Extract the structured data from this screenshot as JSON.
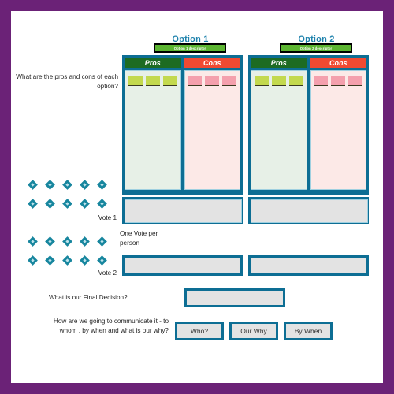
{
  "board": {
    "frame_color": "#6b2277",
    "canvas_color": "#ffffff",
    "accent_teal": "#0d6e94",
    "title_color": "#2083ad",
    "pros_color": "#1d6b22",
    "cons_color": "#f04a32",
    "sticky_green": "#c3d94e",
    "sticky_pink": "#f4a0ad",
    "box_fill": "#e3e3e3",
    "diamond_color": "#17869e"
  },
  "options": [
    {
      "title": "Option 1",
      "descriptor": "Option 1 descriptor",
      "pros_header": "Pros",
      "cons_header": "Cons",
      "pros_notes": 3,
      "cons_notes": 3
    },
    {
      "title": "Option 2",
      "descriptor": "Option 2 descriptor",
      "pros_header": "Pros",
      "cons_header": "Cons",
      "pros_notes": 3,
      "cons_notes": 3
    }
  ],
  "prompts": {
    "pros_cons_question": "What are the pros and cons of each option?",
    "one_vote_note": "One Vote per person",
    "final_decision_question": "What is our Final Decision?",
    "communicate_question": "How are we going to communicate it - to whom , by when and what is our why?"
  },
  "votes": [
    {
      "label": "Vote 1",
      "dots_rows": 2,
      "dots_per_row": 5
    },
    {
      "label": "Vote 2",
      "dots_rows": 2,
      "dots_per_row": 5
    }
  ],
  "vote_boxes": {
    "vote1": [
      "",
      ""
    ],
    "vote2": [
      "",
      ""
    ]
  },
  "final_decision": {
    "value": ""
  },
  "actions": [
    {
      "label": "Who?"
    },
    {
      "label": "Our Why"
    },
    {
      "label": "By When"
    }
  ]
}
